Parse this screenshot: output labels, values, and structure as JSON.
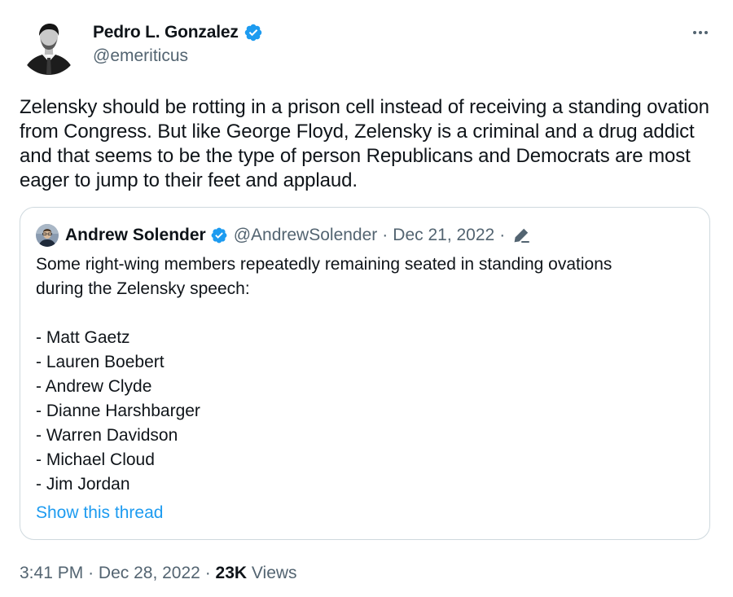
{
  "tweet": {
    "author": {
      "name": "Pedro L. Gonzalez",
      "handle": "@emeriticus",
      "verified": true
    },
    "text": "Zelensky should be rotting in a prison cell instead of receiving a standing ovation from Congress. But like George Floyd, Zelensky is a criminal and a drug addict and that seems to be the type of person Republicans and Democrats are most eager to jump to their feet and applaud.",
    "quote": {
      "author": {
        "name": "Andrew Solender",
        "handle": "@AndrewSolender",
        "verified": true
      },
      "separator": "·",
      "date": "Dec 21, 2022",
      "lines": [
        "Some right-wing members repeatedly remaining seated in standing ovations",
        "during the Zelensky speech:",
        "",
        "- Matt Gaetz",
        "- Lauren Boebert",
        "- Andrew Clyde",
        "- Dianne Harshbarger",
        "- Warren Davidson",
        "- Michael Cloud",
        "- Jim Jordan"
      ],
      "show_thread_label": "Show this thread"
    },
    "footer": {
      "time": "3:41 PM",
      "separator": "·",
      "date": "Dec 28, 2022",
      "views_count": "23K",
      "views_label": "Views"
    }
  },
  "colors": {
    "text": "#0f1419",
    "secondary": "#536471",
    "accent": "#1d9bf0",
    "border": "#cfd9de",
    "verified": "#1d9bf0"
  },
  "icons": {
    "verified": "verified-badge-icon",
    "more": "more-options-icon",
    "edited": "edit-pencil-icon"
  }
}
